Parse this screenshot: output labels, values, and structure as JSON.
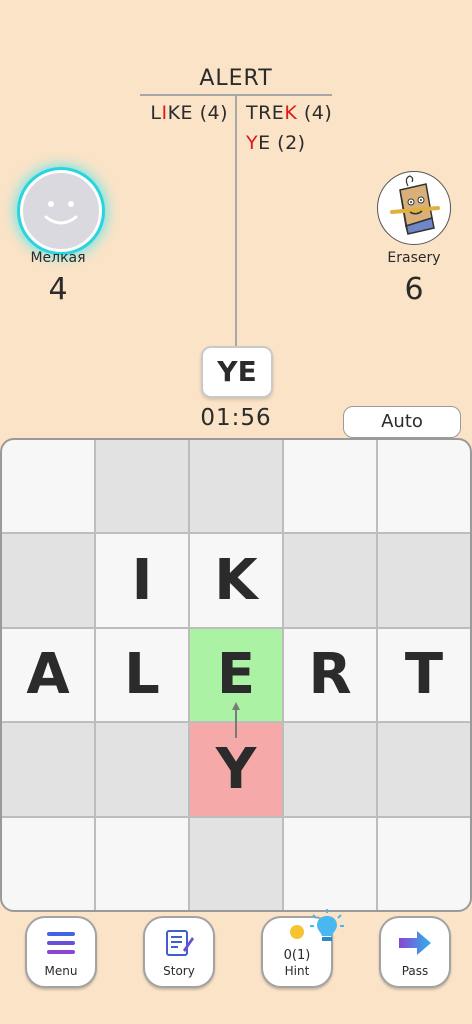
{
  "history": {
    "start_word": "ALERT",
    "player1_words": [
      {
        "pre": "L",
        "hl": "I",
        "post": "KE (4)"
      }
    ],
    "player2_words": [
      {
        "pre": "TRE",
        "hl": "K",
        "post": " (4)"
      },
      {
        "pre": "",
        "hl": "Y",
        "post": "E (2)"
      }
    ]
  },
  "players": {
    "p1": {
      "name": "Мелкая",
      "score": "4"
    },
    "p2": {
      "name": "Erasery",
      "score": "6"
    }
  },
  "current_word": "YE",
  "timer": "01:56",
  "auto_label": "Auto",
  "board": {
    "rows": [
      [
        "",
        "",
        "",
        "",
        ""
      ],
      [
        "",
        "I",
        "K",
        "",
        ""
      ],
      [
        "A",
        "L",
        "E",
        "R",
        "T"
      ],
      [
        "",
        "",
        "Y",
        "",
        ""
      ],
      [
        "",
        "",
        "",
        "",
        ""
      ]
    ]
  },
  "buttons": {
    "menu": "Menu",
    "story": "Story",
    "hint": "Hint",
    "hint_count": "0(1)",
    "pass": "Pass"
  },
  "colors": {
    "background": "#fbe3c7",
    "highlight_letter": "#d91b1b",
    "selected_cell": "#acf2a5",
    "new_cell": "#f5a9a9",
    "active_glow": "#2cd3dc"
  }
}
